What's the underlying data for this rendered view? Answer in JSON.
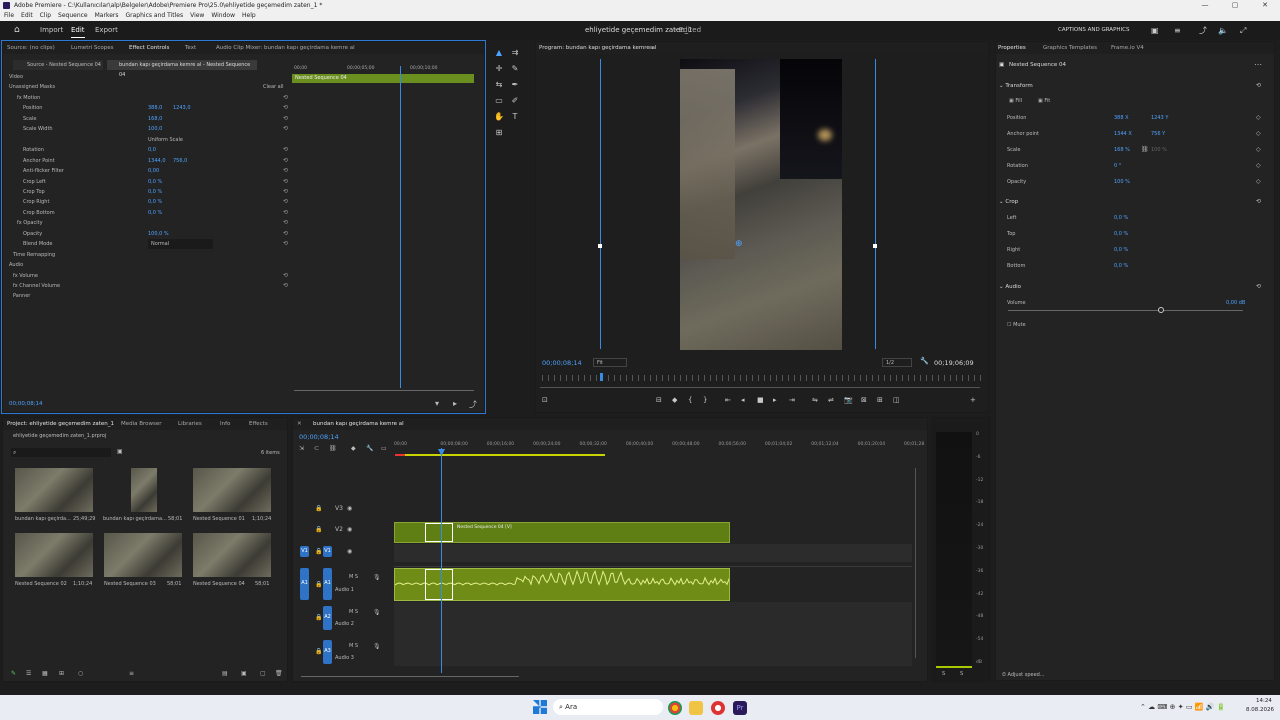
{
  "window": {
    "title": "Adobe Premiere - C:\\Kullanıcılar\\alp\\Belgeler\\Adobe\\Premiere Pro\\25.0\\ehliyetide geçemedim zaten_1 *",
    "controls": [
      "—",
      "▢",
      "✕"
    ]
  },
  "menu": [
    "File",
    "Edit",
    "Clip",
    "Sequence",
    "Markers",
    "Graphics and Titles",
    "View",
    "Window",
    "Help"
  ],
  "header": {
    "tabs": [
      "Import",
      "Edit",
      "Export"
    ],
    "active_tab": "Edit",
    "project_title": "ehliyetide geçemedim zaten_1",
    "edited": "- Edited",
    "captions_label": "CAPTIONS AND GRAPHICS"
  },
  "effect_controls": {
    "tabs": [
      "Source: (no clips)",
      "Lumetri Scopes",
      "Effect Controls",
      "Text",
      "Audio Clip Mixer: bundan kapı geçirdama kemre al"
    ],
    "source": "Source - Nested Sequence 04",
    "clip": "bundan kapı geçirdama kemre al - Nested Sequence 04",
    "timeline_clip": "Nested Sequence 04",
    "ruler_times": [
      "00;00",
      "00;00;05;00",
      "00;00;10;00"
    ],
    "rows": [
      {
        "label": "Video",
        "value": "",
        "value2": ""
      },
      {
        "label": "Unassigned Masks",
        "value": "",
        "value2": "Clear all"
      },
      {
        "label": "fx  Motion",
        "value": "",
        "value2": ""
      },
      {
        "label": "Position",
        "value": "388,0",
        "value2": "1243,0"
      },
      {
        "label": "Scale",
        "value": "168,0",
        "value2": ""
      },
      {
        "label": "Scale Width",
        "value": "100,0",
        "value2": ""
      },
      {
        "label": "",
        "value": "Uniform Scale",
        "value2": ""
      },
      {
        "label": "Rotation",
        "value": "0,0",
        "value2": ""
      },
      {
        "label": "Anchor Point",
        "value": "1344,0",
        "value2": "756,0"
      },
      {
        "label": "Anti-flicker Filter",
        "value": "0,00",
        "value2": ""
      },
      {
        "label": "Crop Left",
        "value": "0,0 %",
        "value2": ""
      },
      {
        "label": "Crop Top",
        "value": "0,0 %",
        "value2": ""
      },
      {
        "label": "Crop Right",
        "value": "0,0 %",
        "value2": ""
      },
      {
        "label": "Crop Bottom",
        "value": "0,0 %",
        "value2": ""
      },
      {
        "label": "fx  Opacity",
        "value": "",
        "value2": ""
      },
      {
        "label": "Opacity",
        "value": "100,0 %",
        "value2": ""
      },
      {
        "label": "Blend Mode",
        "value": "Normal",
        "value2": ""
      },
      {
        "label": "Time Remapping",
        "value": "",
        "value2": ""
      },
      {
        "label": "Audio",
        "value": "",
        "value2": ""
      },
      {
        "label": "fx  Volume",
        "value": "",
        "value2": ""
      },
      {
        "label": "fx  Channel Volume",
        "value": "",
        "value2": ""
      },
      {
        "label": "Panner",
        "value": "",
        "value2": ""
      }
    ],
    "timecode": "00;00;08;14"
  },
  "program": {
    "title": "Program: bundan kapı geçirdama kemre al",
    "timecode": "00;00;08;14",
    "fit": "Fit",
    "resolution": "1/2",
    "duration": "00;19;06;09"
  },
  "properties": {
    "tabs": [
      "Properties",
      "Graphics Templates",
      "Frame.io V4"
    ],
    "clip_name": "Nested Sequence 04",
    "transform": {
      "title": "Transform",
      "fill": "Fill",
      "fit": "Fit",
      "position_label": "Position",
      "position_x": "388 X",
      "position_y": "1243 Y",
      "anchor_label": "Anchor point",
      "anchor_x": "1344 X",
      "anchor_y": "756 Y",
      "scale_label": "Scale",
      "scale_value": "168 %",
      "scale_value2": "100 %",
      "rotation_label": "Rotation",
      "rotation_value": "0 °",
      "opacity_label": "Opacity",
      "opacity_value": "100 %"
    },
    "crop": {
      "title": "Crop",
      "left_label": "Left",
      "left_value": "0,0 %",
      "top_label": "Top",
      "top_value": "0,0 %",
      "right_label": "Right",
      "right_value": "0,0 %",
      "bottom_label": "Bottom",
      "bottom_value": "0,0 %"
    },
    "audio": {
      "title": "Audio",
      "volume_label": "Volume",
      "volume_value": "0,00 dB",
      "mute_label": "Mute"
    },
    "adjust_speed": "Adjust speed..."
  },
  "project": {
    "tabs": [
      "Project: ehliyetide geçemedim zaten_1",
      "Media Browser",
      "Libraries",
      "Info",
      "Effects"
    ],
    "file": "ehliyetide geçemedim zaten_1.prproj",
    "items_count": "6 items",
    "items": [
      {
        "name": "bundan kapı geçirda...",
        "duration": "25;49;29"
      },
      {
        "name": "bundan kapı geçirdama...",
        "duration": "58;01"
      },
      {
        "name": "Nested Sequence 01",
        "duration": "1;10;24"
      },
      {
        "name": "Nested Sequence 02",
        "duration": "1;10;24"
      },
      {
        "name": "Nested Sequence 03",
        "duration": "58;01"
      },
      {
        "name": "Nested Sequence 04",
        "duration": "58;01"
      }
    ]
  },
  "timeline": {
    "tab": "bundan kapı geçirdama kemre al",
    "timecode": "00;00;08;14",
    "ruler": [
      "00;00",
      "00;00;08;00",
      "00;00;16;00",
      "00;00;24;00",
      "00;00;32;00",
      "00;00;40;00",
      "00;00;48;00",
      "00;00;56;00",
      "00;01;04;02",
      "00;01;12;04",
      "00;01;20;04",
      "00;01;28"
    ],
    "video_tracks": [
      "V3",
      "V2",
      "V1"
    ],
    "audio_tracks": [
      {
        "name": "A1",
        "label": "Audio 1"
      },
      {
        "name": "A2",
        "label": "Audio 2"
      },
      {
        "name": "A3",
        "label": "Audio 3"
      }
    ],
    "clip_label": "Nested Sequence 04 [V]",
    "meter_scale": [
      "0",
      "-6",
      "-12",
      "-18",
      "-24",
      "-30",
      "-36",
      "-42",
      "-48",
      "-54",
      "dB"
    ],
    "meter_bottom": [
      "S",
      "S"
    ]
  },
  "taskbar": {
    "search": "Ara",
    "time": "14:24",
    "date": "8.08.2026"
  }
}
